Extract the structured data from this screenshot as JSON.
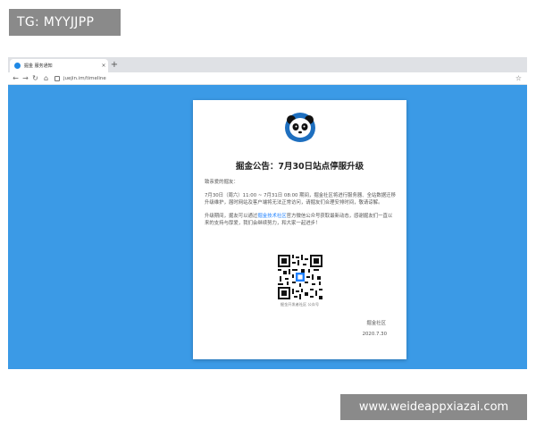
{
  "watermark": {
    "top_left": "TG: MYYJJPP",
    "bottom_right": "www.weideappxiazai.com"
  },
  "browser": {
    "tab_title": "掘金 服务通知",
    "tab_close": "×",
    "new_tab": "+",
    "url": "juejin.im/timeline",
    "icons": [
      "back-arrow-icon",
      "forward-arrow-icon",
      "reload-icon",
      "home-icon",
      "lock-icon",
      "star-icon"
    ]
  },
  "announcement": {
    "title": "掘金公告：7月30日站点停服升级",
    "greeting": "致亲爱的掘友：",
    "paragraph1": "7月30日（周六）11:00 ~ 7月31日 08:00 期间，掘金社区将进行服务器、全站数据迁移升级维护，届时网站及客户端将无法正常访问，请掘友们合理安排时间，敬请谅解。",
    "paragraph2_pre": "升级期间，掘友可以通过",
    "paragraph2_link": "掘金技术社区",
    "paragraph2_post": "官方微信公众号获取最新动态，感谢掘友们一直以来的支持与厚爱，我们会继续努力，和大家一起进步！",
    "qr_caption": "掘金开发者社区 公众号",
    "signature": "掘金社区",
    "date": "2020.7.30"
  },
  "colors": {
    "page_bg": "#3b9ae6",
    "card_bg": "#ffffff",
    "link": "#1e80ff"
  }
}
